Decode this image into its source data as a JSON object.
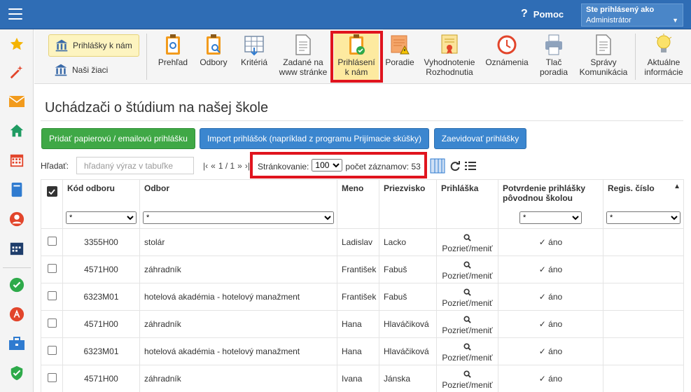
{
  "header": {
    "help_label": "Pomoc",
    "user_line1": "Ste prihlásený ako",
    "user_line2": "Administrátor"
  },
  "sidebar": {
    "icons": [
      "star-icon",
      "magic-wand-icon",
      "envelope-icon",
      "home-icon",
      "calendar-icon",
      "book-icon",
      "person-icon",
      "schedule-icon",
      "check-circle-icon",
      "adobe-icon",
      "briefcase-icon",
      "shield-check-icon"
    ]
  },
  "toolbar": {
    "applications_to_us": "Prihlášky k nám",
    "our_pupils": "Naši žiaci",
    "tools": [
      {
        "l1": "Prehľad",
        "l2": ""
      },
      {
        "l1": "Odbory",
        "l2": ""
      },
      {
        "l1": "Kritériá",
        "l2": ""
      },
      {
        "l1": "Zadané na",
        "l2": "www stránke"
      },
      {
        "l1": "Prihlásení",
        "l2": "k nám"
      },
      {
        "l1": "Poradie",
        "l2": ""
      },
      {
        "l1": "Vyhodnotenie",
        "l2": "Rozhodnutia"
      },
      {
        "l1": "Oznámenia",
        "l2": ""
      },
      {
        "l1": "Tlač",
        "l2": "poradia"
      },
      {
        "l1": "Správy",
        "l2": "Komunikácia"
      },
      {
        "l1": "Aktuálne",
        "l2": "informácie"
      }
    ]
  },
  "main": {
    "title": "Uchádzači o štúdium na našej škole",
    "btn_add": "Pridať papierovú / emailovú prihlášku",
    "btn_import": "Import prihlášok (napríklad z programu Prijímacie skúšky)",
    "btn_register": "Zaevidovať prihlášky",
    "search_label": "Hľadať:",
    "search_placeholder": "hľadaný výraz v tabuľke",
    "pager": {
      "first": "|‹",
      "prev": "«",
      "pages": "1 / 1",
      "next": "»",
      "last": "›|"
    },
    "paging_label": "Stránkovanie:",
    "page_size": "100",
    "records_label": "počet záznamov: 53"
  },
  "table": {
    "headers": {
      "code": "Kód odboru",
      "field": "Odbor",
      "first_name": "Meno",
      "last_name": "Priezvisko",
      "application": "Prihláška",
      "confirmation_l1": "Potvrdenie prihlášky",
      "confirmation_l2": "pôvodnou školou",
      "reg_no": "Regis. číslo"
    },
    "filter_value": "*",
    "rows": [
      {
        "code": "3355H00",
        "field": "stolár",
        "first_name": "Ladislav",
        "last_name": "Lacko",
        "view": "Pozrieť/meniť",
        "confirmed": "✓ áno",
        "reg": ""
      },
      {
        "code": "4571H00",
        "field": "záhradník",
        "first_name": "František",
        "last_name": "Fabuš",
        "view": "Pozrieť/meniť",
        "confirmed": "✓ áno",
        "reg": ""
      },
      {
        "code": "6323M01",
        "field": "hotelová akadémia - hotelový manažment",
        "first_name": "František",
        "last_name": "Fabuš",
        "view": "Pozrieť/meniť",
        "confirmed": "✓ áno",
        "reg": ""
      },
      {
        "code": "4571H00",
        "field": "záhradník",
        "first_name": "Hana",
        "last_name": "Hlaváčiková",
        "view": "Pozrieť/meniť",
        "confirmed": "✓ áno",
        "reg": ""
      },
      {
        "code": "6323M01",
        "field": "hotelová akadémia - hotelový manažment",
        "first_name": "Hana",
        "last_name": "Hlaváčiková",
        "view": "Pozrieť/meniť",
        "confirmed": "✓ áno",
        "reg": ""
      },
      {
        "code": "4571H00",
        "field": "záhradník",
        "first_name": "Ivana",
        "last_name": "Jánska",
        "view": "Pozrieť/meniť",
        "confirmed": "✓ áno",
        "reg": ""
      }
    ]
  },
  "colors": {
    "topbar": "#2f6db5",
    "green_button": "#3fa846",
    "blue_button": "#3b86cf",
    "highlight_red": "#e0141e",
    "active_tool": "#fdeaa0"
  }
}
